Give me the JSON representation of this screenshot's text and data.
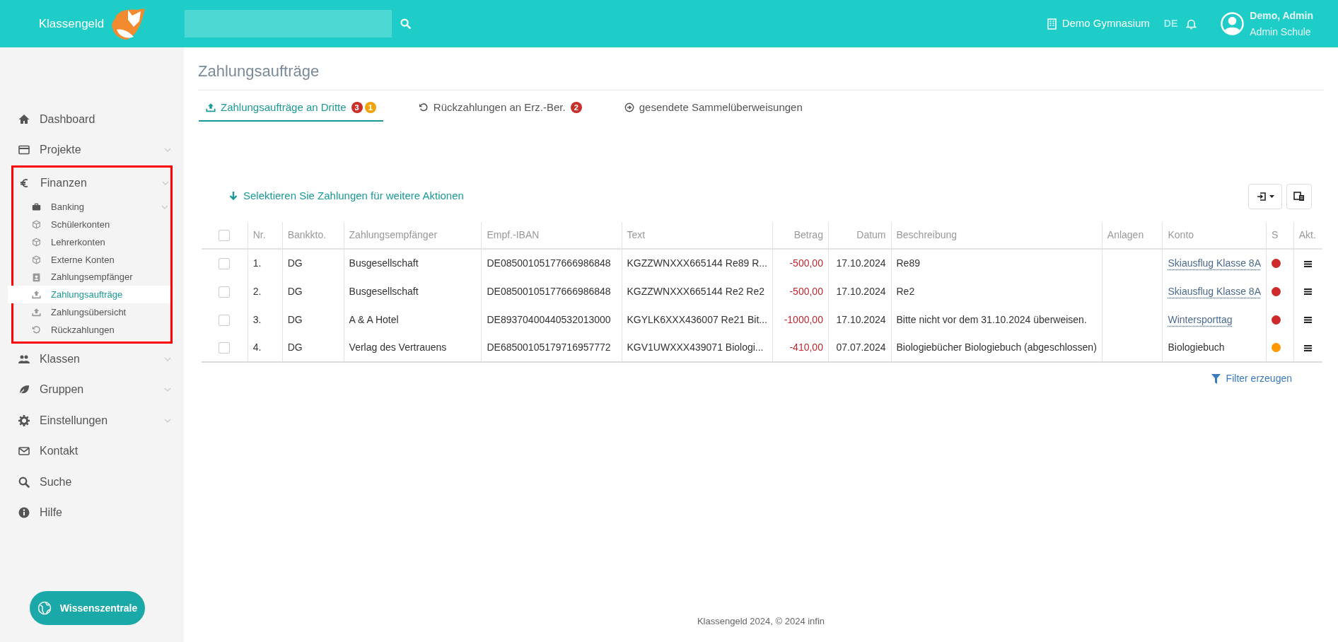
{
  "header": {
    "brand": "Klassengeld",
    "school": "Demo Gymnasium",
    "language": {
      "code": "DE",
      "selected": true
    },
    "user": {
      "name": "Demo, Admin",
      "role": "Admin Schule"
    }
  },
  "sidebar": {
    "items": [
      {
        "label": "Dashboard",
        "expandable": false,
        "selected": false
      },
      {
        "label": "Projekte",
        "expandable": true,
        "selected": false
      },
      {
        "label": "Finanzen",
        "expandable": true,
        "selected": false,
        "highlighted": true,
        "children": [
          {
            "label": "Banking",
            "expandable": true,
            "selected": false
          },
          {
            "label": "Schülerkonten",
            "expandable": false,
            "selected": false
          },
          {
            "label": "Lehrerkonten",
            "expandable": false,
            "selected": false
          },
          {
            "label": "Externe Konten",
            "expandable": false,
            "selected": false
          },
          {
            "label": "Zahlungsempfänger",
            "expandable": false,
            "selected": false
          },
          {
            "label": "Zahlungsaufträge",
            "expandable": false,
            "selected": true
          },
          {
            "label": "Zahlungsübersicht",
            "expandable": false,
            "selected": false
          },
          {
            "label": "Rückzahlungen",
            "expandable": false,
            "selected": false
          }
        ]
      },
      {
        "label": "Klassen",
        "expandable": true,
        "selected": false
      },
      {
        "label": "Gruppen",
        "expandable": true,
        "selected": false
      },
      {
        "label": "Einstellungen",
        "expandable": true,
        "selected": false
      },
      {
        "label": "Kontakt",
        "expandable": false,
        "selected": false
      },
      {
        "label": "Suche",
        "expandable": false,
        "selected": false
      },
      {
        "label": "Hilfe",
        "expandable": false,
        "selected": false
      }
    ],
    "help_button": "Wissenszentrale"
  },
  "page": {
    "title": "Zahlungsaufträge",
    "tabs": [
      {
        "label": "Zahlungsaufträge an Dritte",
        "selected": true,
        "badges": [
          {
            "text": "3",
            "color": "#c9302c"
          },
          {
            "text": "1",
            "color": "#f0a30a"
          }
        ]
      },
      {
        "label": "Rückzahlungen an Erz.-Ber.",
        "selected": false,
        "badges": [
          {
            "text": "2",
            "color": "#c9302c"
          }
        ]
      },
      {
        "label": "gesendete Sammelüberweisungen",
        "selected": false
      }
    ],
    "action_hint": "Selektieren Sie Zahlungen für weitere Aktionen",
    "table": {
      "all_checked": false,
      "columns": [
        "Nr.",
        "Bankkto.",
        "Zahlungsempfänger",
        "Empf.-IBAN",
        "Text",
        "Betrag",
        "Datum",
        "Beschreibung",
        "Anlagen",
        "Konto",
        "S",
        "Akt."
      ],
      "rows": [
        {
          "checked": false,
          "nr": "1.",
          "bank": "DG",
          "recipient": "Busgesellschaft",
          "iban": "DE08500105177666986848",
          "text": "KGZZWNXXX665144 Re89 R...",
          "amount": "-500,00",
          "date": "17.10.2024",
          "description": "Re89",
          "account": "Skiausflug Klasse 8A",
          "account_linked": true,
          "color": "#cc2a2a"
        },
        {
          "checked": false,
          "nr": "2.",
          "bank": "DG",
          "recipient": "Busgesellschaft",
          "iban": "DE08500105177666986848",
          "text": "KGZZWNXXX665144 Re2 Re2",
          "amount": "-500,00",
          "date": "17.10.2024",
          "description": "Re2",
          "account": "Skiausflug Klasse 8A",
          "account_linked": true,
          "color": "#cc2a2a"
        },
        {
          "checked": false,
          "nr": "3.",
          "bank": "DG",
          "recipient": "A & A Hotel",
          "iban": "DE89370400440532013000",
          "text": "KGYLK6XXX436007 Re21 Bit...",
          "amount": "-1000,00",
          "date": "17.10.2024",
          "description": "Bitte nicht vor dem 31.10.2024 überweisen.",
          "account": "Wintersporttag",
          "account_linked": true,
          "color": "#cc2a2a"
        },
        {
          "checked": false,
          "nr": "4.",
          "bank": "DG",
          "recipient": "Verlag des Vertrauens",
          "iban": "DE68500105179716957772",
          "text": "KGV1UWXXX439071 Biologi...",
          "amount": "-410,00",
          "date": "07.07.2024",
          "description": "Biologiebücher Biologiebuch (abgeschlossen)",
          "account": "Biologiebuch",
          "account_linked": false,
          "color": "#ff9800"
        }
      ]
    },
    "filter_link": "Filter erzeugen"
  },
  "footer": "Klassengeld 2024, © 2024 infin"
}
